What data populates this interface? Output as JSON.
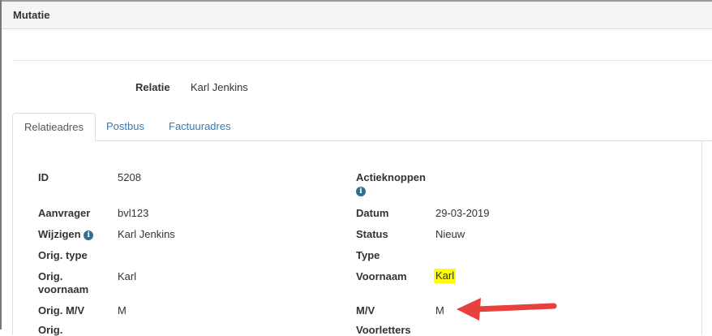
{
  "panel": {
    "title": "Mutatie"
  },
  "relatie": {
    "label": "Relatie",
    "value": "Karl Jenkins"
  },
  "tabs": [
    {
      "label": "Relatieadres",
      "active": true
    },
    {
      "label": "Postbus",
      "active": false
    },
    {
      "label": "Factuuradres",
      "active": false
    }
  ],
  "left_fields": [
    {
      "label": "ID",
      "value": "5208"
    },
    {
      "label": "Aanvrager",
      "value": "bvl123"
    },
    {
      "label": "Wijzigen",
      "value": "Karl Jenkins",
      "info_icon": "info-icon"
    },
    {
      "label": "Orig. type",
      "value": ""
    },
    {
      "label": "Orig. voornaam",
      "value": "Karl"
    },
    {
      "label": "Orig. M/V",
      "value": "M"
    }
  ],
  "right_fields": [
    {
      "label": "Actieknoppen",
      "value": "",
      "info_icon": "info-icon"
    },
    {
      "label": "Datum",
      "value": "29-03-2019"
    },
    {
      "label": "Status",
      "value": "Nieuw"
    },
    {
      "label": "Type",
      "value": ""
    },
    {
      "label": "Voornaam",
      "value": "Karl",
      "highlight": "#ffff00"
    },
    {
      "label": "M/V",
      "value": "M"
    }
  ],
  "annotation": {
    "arrow_color": "#e8403c"
  },
  "colors": {
    "link": "#337ab7",
    "info": "#31708f",
    "highlight": "#ffff00"
  }
}
